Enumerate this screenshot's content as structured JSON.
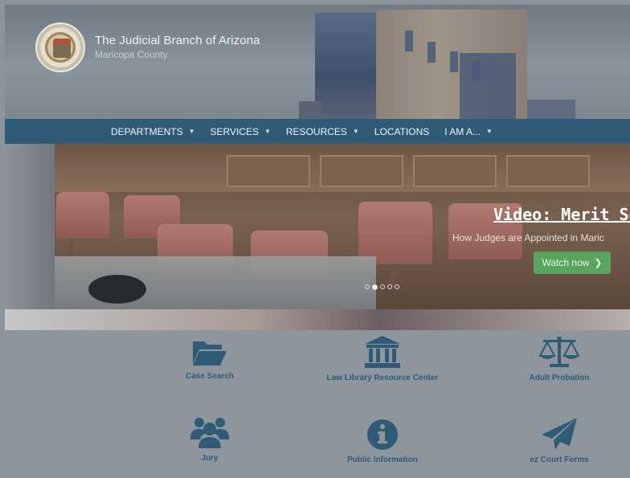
{
  "header": {
    "title": "The Judicial Branch of Arizona",
    "subtitle": "Maricopa County"
  },
  "nav": {
    "items": [
      {
        "label": "DEPARTMENTS",
        "has_caret": true
      },
      {
        "label": "SERVICES",
        "has_caret": true
      },
      {
        "label": "RESOURCES",
        "has_caret": true
      },
      {
        "label": "LOCATIONS",
        "has_caret": false
      },
      {
        "label": "I AM A...",
        "has_caret": true
      }
    ]
  },
  "hero": {
    "title": "Video: Merit Select",
    "subtitle": "How Judges are Appointed in Maric",
    "button_label": "Watch now",
    "slides": 5,
    "active_slide": 1
  },
  "quick_links": [
    {
      "label": "Case Search",
      "icon": "folder-open-icon"
    },
    {
      "label": "Law Library Resource Center",
      "icon": "courthouse-icon"
    },
    {
      "label": "Adult Probation",
      "icon": "scales-icon"
    },
    {
      "label": "Jury",
      "icon": "users-icon"
    },
    {
      "label": "Public Information",
      "icon": "info-circle-icon"
    },
    {
      "label": "ez Court Forms",
      "icon": "paper-plane-icon"
    }
  ],
  "colors": {
    "nav_bar": "#2f5b76",
    "link_text": "#2f5b76",
    "button_green": "#59a45e"
  }
}
